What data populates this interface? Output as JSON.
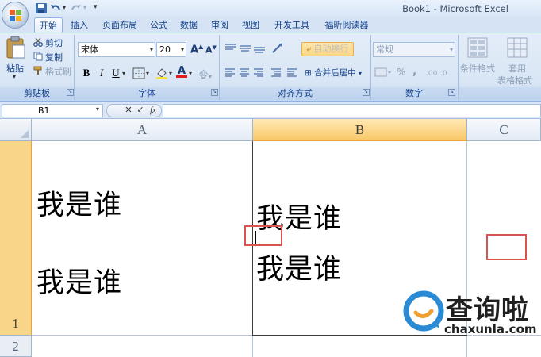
{
  "window": {
    "title": "Book1 - Microsoft Excel"
  },
  "quick_access": {
    "save_icon": "save-icon",
    "undo_icon": "undo-icon",
    "redo_icon": "redo-icon",
    "customize": "▾"
  },
  "tabs": [
    {
      "label": "开始",
      "active": true
    },
    {
      "label": "插入"
    },
    {
      "label": "页面布局"
    },
    {
      "label": "公式"
    },
    {
      "label": "数据"
    },
    {
      "label": "审阅"
    },
    {
      "label": "视图"
    },
    {
      "label": "开发工具"
    },
    {
      "label": "福昕阅读器"
    }
  ],
  "ribbon": {
    "clipboard": {
      "label": "剪贴板",
      "paste": "粘贴",
      "cut": "剪切",
      "copy": "复制",
      "format_painter": "格式刷"
    },
    "font": {
      "label": "字体",
      "font_name": "宋体",
      "font_size": "20",
      "grow": "A",
      "shrink": "A",
      "bold": "B",
      "italic": "I",
      "underline": "U",
      "font_color_letter": "A",
      "phonetic": "变"
    },
    "alignment": {
      "label": "对齐方式",
      "wrap_text": "自动换行",
      "merge_center": "合并后居中"
    },
    "number": {
      "label": "数字",
      "format": "常规",
      "percent": "%",
      "comma": ","
    },
    "styles": {
      "conditional_format": "条件格式",
      "format_as_table_1": "套用",
      "format_as_table_2": "表格格式"
    }
  },
  "formula_bar": {
    "name_box": "B1",
    "cancel": "✕",
    "enter": "✓",
    "fx": "fx",
    "value": ""
  },
  "sheet": {
    "columns": [
      "A",
      "B",
      "C"
    ],
    "selected_column": "B",
    "rows": [
      "1",
      "2"
    ],
    "selected_row": "1",
    "cells": {
      "A1_line1": "我是谁",
      "A1_line2": "我是谁",
      "B1_line1": "我是谁",
      "B1_line2": "我是谁"
    }
  },
  "watermark": {
    "name": "查询啦",
    "url": "chaxunla.com"
  },
  "colors": {
    "accent_red": "#d9534f",
    "ribbon_text": "#15428b",
    "selected_header": "#f9c866",
    "wrap_text_highlight": "#fbd685"
  }
}
